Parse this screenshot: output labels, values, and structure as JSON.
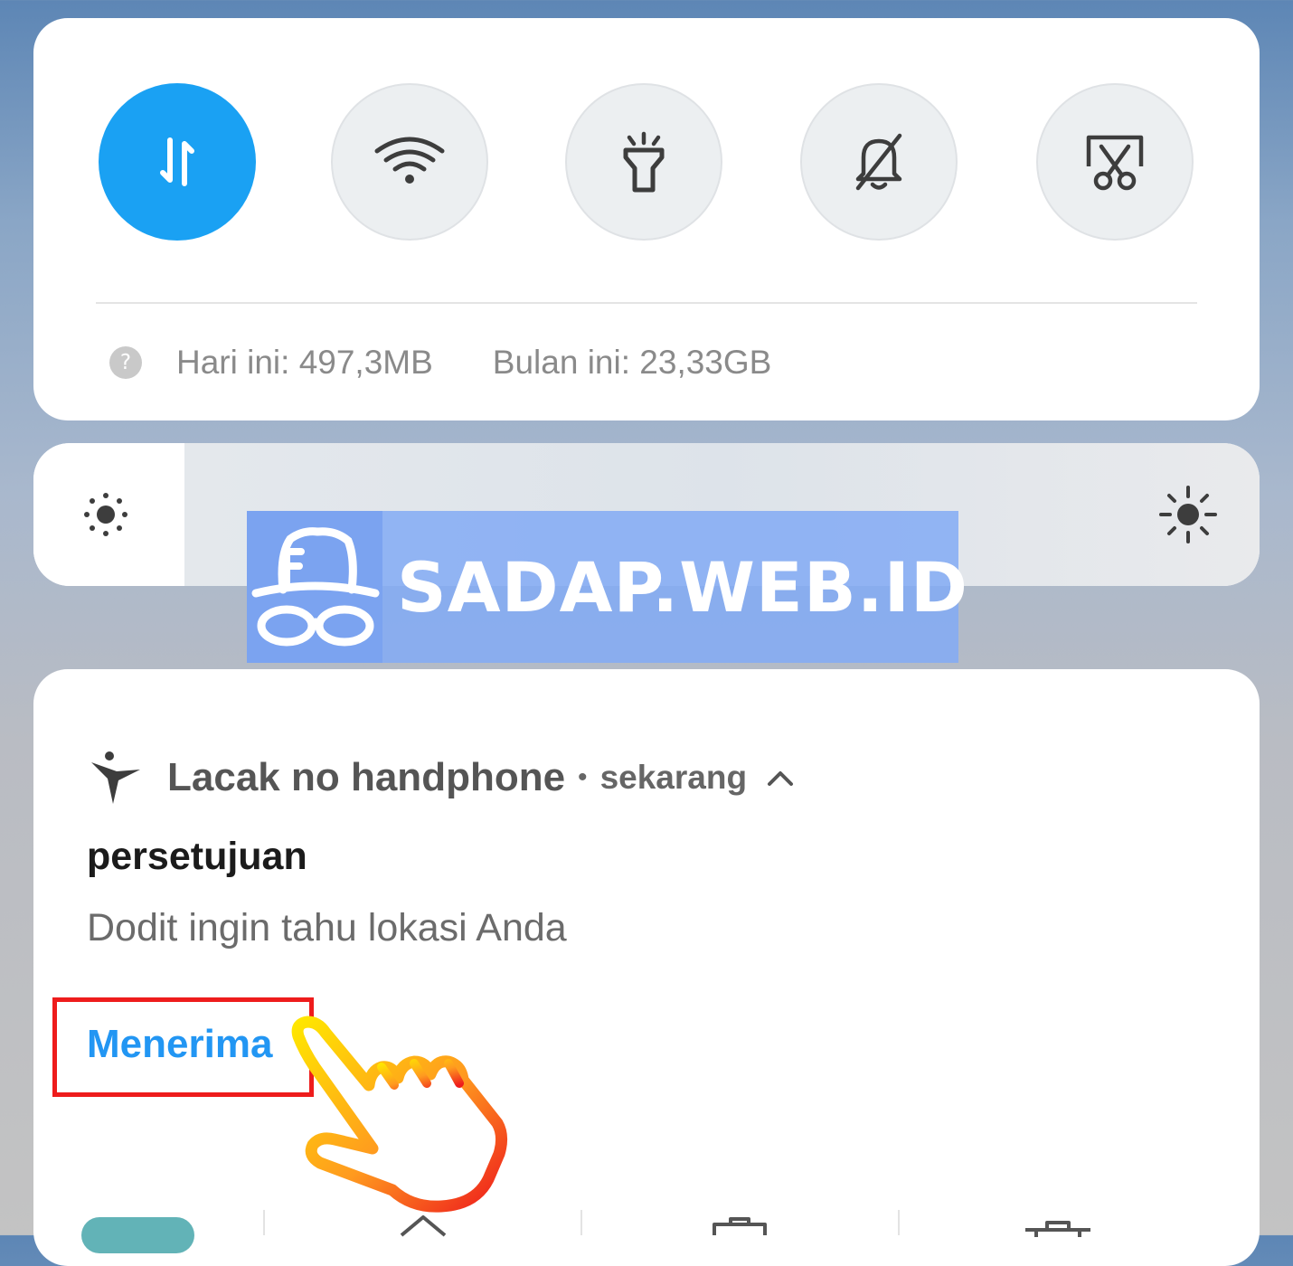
{
  "quick_settings": {
    "tiles": [
      {
        "name": "mobile-data",
        "icon": "data-transfer-icon",
        "active": true
      },
      {
        "name": "wifi",
        "icon": "wifi-icon",
        "active": false
      },
      {
        "name": "flashlight",
        "icon": "flashlight-icon",
        "active": false
      },
      {
        "name": "mute",
        "icon": "bell-off-icon",
        "active": false
      },
      {
        "name": "screenshot",
        "icon": "screenshot-scissors-icon",
        "active": false
      }
    ],
    "usage_today": "Hari ini: 497,3MB",
    "usage_month": "Bulan ini: 23,33GB"
  },
  "brightness": {
    "level": 0.0
  },
  "watermark": {
    "text": "SADAP.WEB.ID"
  },
  "notification": {
    "app_name": "Lacak no handphone",
    "separator": "•",
    "time": "sekarang",
    "title": "persetujuan",
    "body": "Dodit ingin tahu lokasi Anda",
    "action_label": "Menerima"
  },
  "colors": {
    "accent": "#1aa1f3",
    "action": "#2296f3",
    "highlight": "#ee1c1c"
  }
}
